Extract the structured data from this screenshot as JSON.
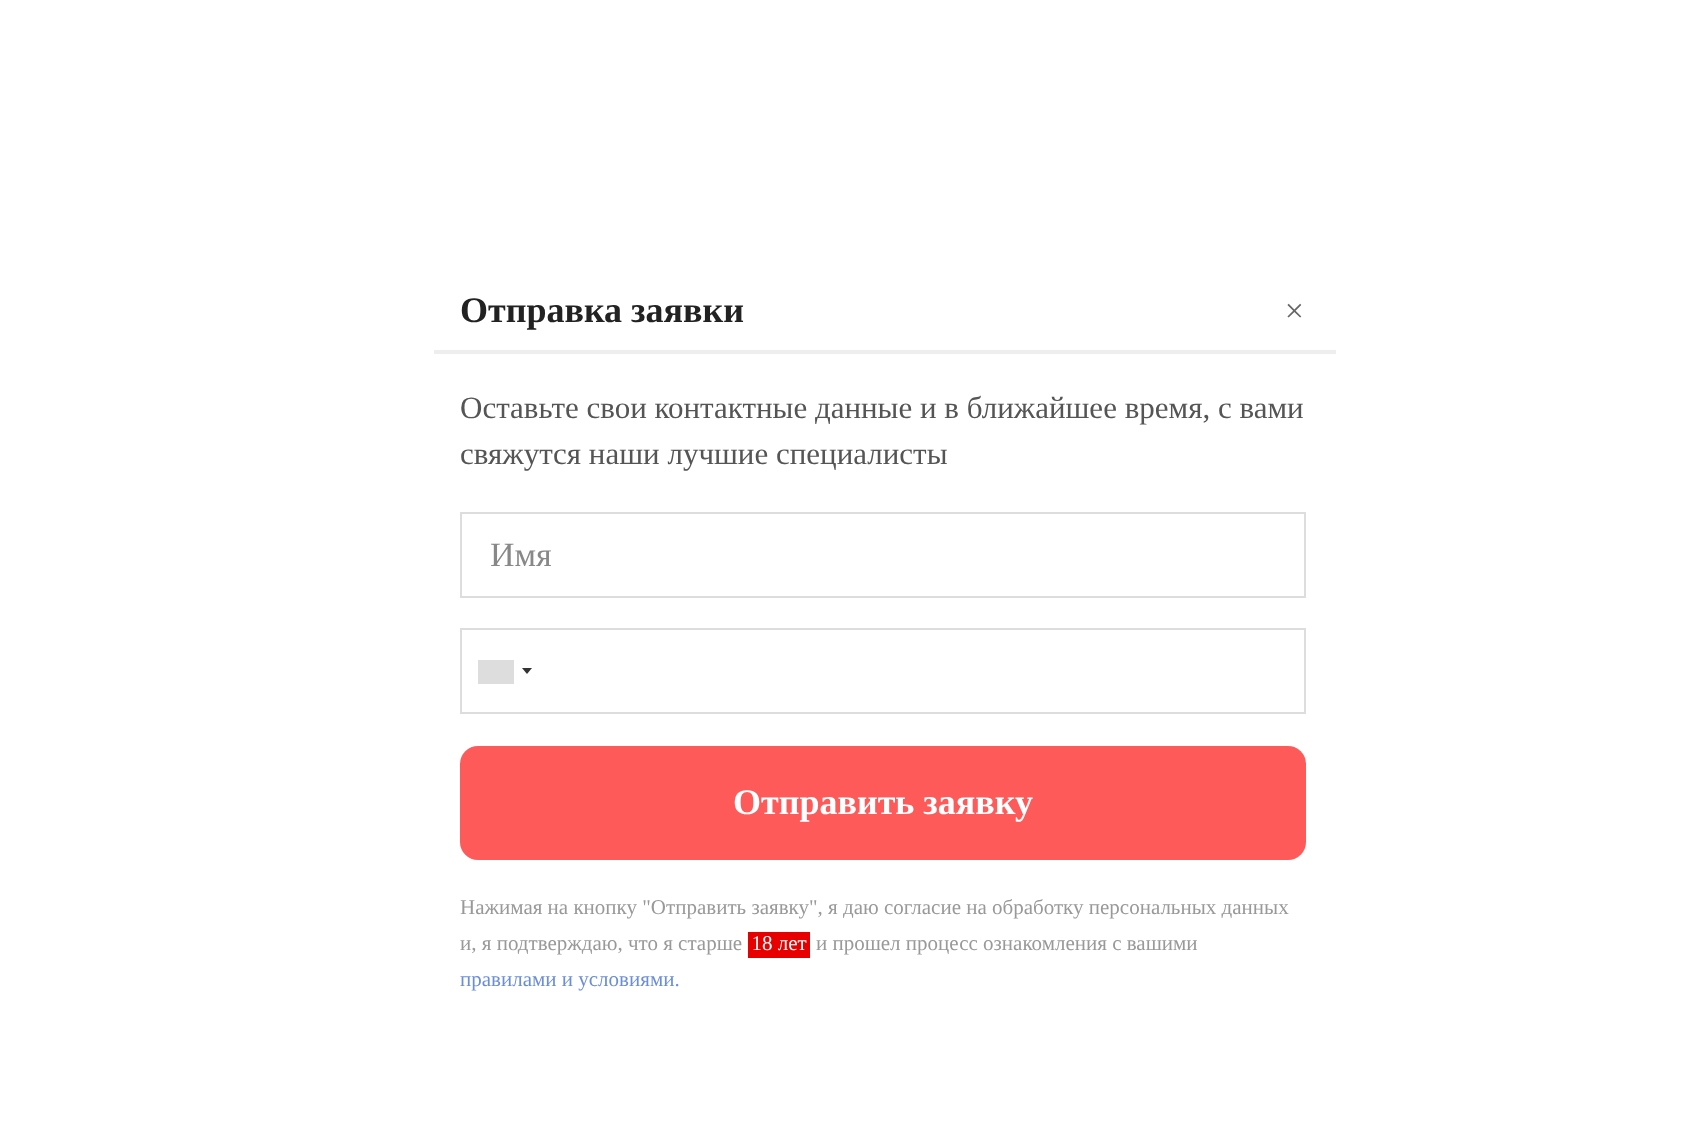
{
  "dialog": {
    "title": "Отправка заявки",
    "close": "×",
    "description": "Оставьте свои контактные данные и в ближайшее время, с вами свяжутся наши лучшие специалисты",
    "fields": [
      {
        "kind": "text",
        "placeholder": "Имя"
      },
      {
        "kind": "phone"
      }
    ],
    "submit": "Отправить заявку",
    "consent": {
      "before": "Нажимая на кнопку \"Отправить заявку\", я даю согласие на обработку персональных данных и, я подтверждаю, что я старше",
      "highlight": "18 лет",
      "after": "и прошел процесс ознакомления с вашими",
      "link": "правилами и условиями."
    }
  }
}
